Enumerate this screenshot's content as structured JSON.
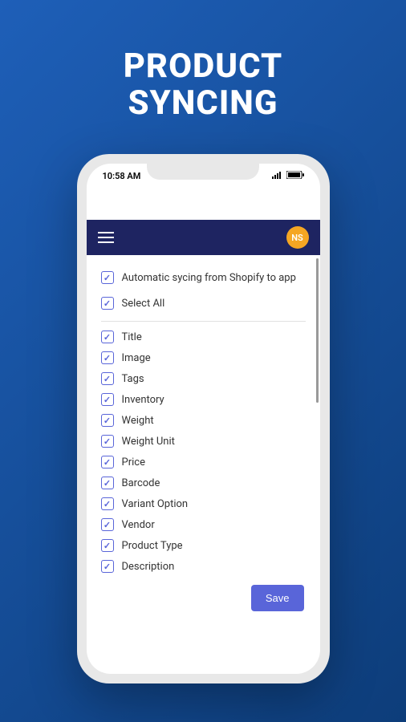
{
  "hero": {
    "title_line1": "PRODUCT",
    "title_line2": "SYNCING"
  },
  "statusBar": {
    "time": "10:58 AM"
  },
  "header": {
    "avatar_initials": "NS"
  },
  "content": {
    "automatic_sync": {
      "label": "Automatic sycing from Shopify to app",
      "checked": true
    },
    "select_all": {
      "label": "Select All",
      "checked": true
    },
    "items": [
      {
        "label": "Title",
        "checked": true
      },
      {
        "label": "Image",
        "checked": true
      },
      {
        "label": "Tags",
        "checked": true
      },
      {
        "label": "Inventory",
        "checked": true
      },
      {
        "label": "Weight",
        "checked": true
      },
      {
        "label": "Weight Unit",
        "checked": true
      },
      {
        "label": "Price",
        "checked": true
      },
      {
        "label": "Barcode",
        "checked": true
      },
      {
        "label": "Variant Option",
        "checked": true
      },
      {
        "label": "Vendor",
        "checked": true
      },
      {
        "label": "Product Type",
        "checked": true
      },
      {
        "label": "Description",
        "checked": true
      }
    ],
    "save_label": "Save"
  }
}
